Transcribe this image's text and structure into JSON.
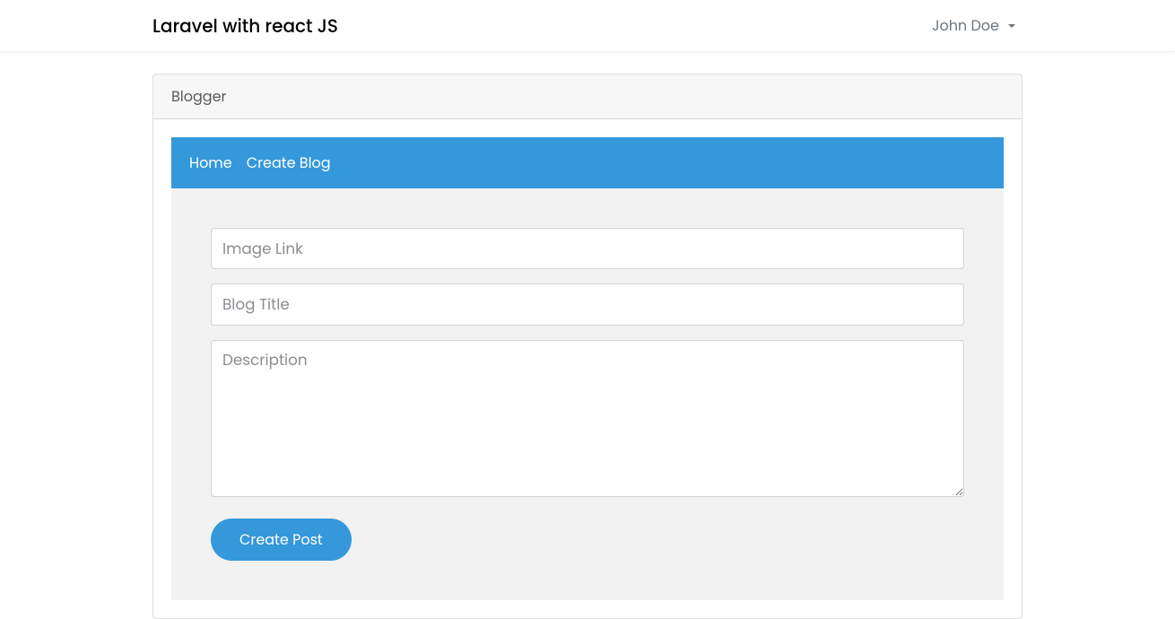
{
  "navbar": {
    "brand": "Laravel with react JS",
    "user_name": "John Doe"
  },
  "card": {
    "header_title": "Blogger"
  },
  "subnav": {
    "home_label": "Home",
    "create_label": "Create Blog"
  },
  "form": {
    "image_link_placeholder": "Image Link",
    "blog_title_placeholder": "Blog Title",
    "description_placeholder": "Description",
    "submit_label": "Create Post"
  }
}
